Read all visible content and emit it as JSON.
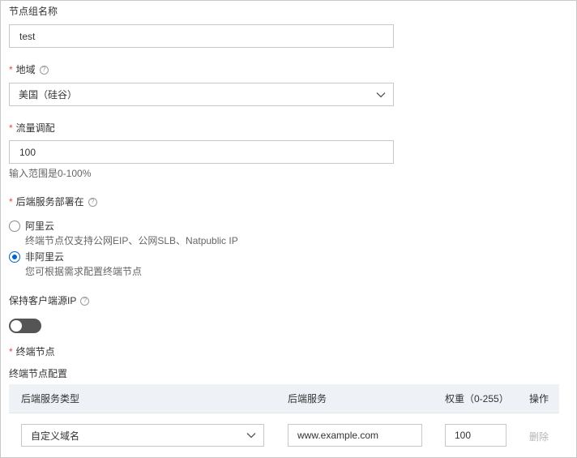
{
  "form": {
    "group_name": {
      "label": "节点组名称",
      "value": "test"
    },
    "region": {
      "label": "地域",
      "value": "美国（硅谷）",
      "required": true
    },
    "traffic": {
      "label": "流量调配",
      "value": "100",
      "hint": "输入范围是0-100%",
      "required": true
    },
    "backend": {
      "label": "后端服务部署在",
      "required": true,
      "options": [
        {
          "title": "阿里云",
          "desc": "终端节点仅支持公网EIP、公网SLB、Natpublic IP",
          "checked": false
        },
        {
          "title": "非阿里云",
          "desc": "您可根据需求配置终端节点",
          "checked": true
        }
      ]
    },
    "keep_ip": {
      "label": "保持客户端源IP",
      "enabled": false
    },
    "endpoint": {
      "label": "终端节点",
      "required": true
    },
    "endpoint_config": {
      "label": "终端节点配置"
    }
  },
  "table": {
    "headers": [
      "后端服务类型",
      "后端服务",
      "权重（0-255）",
      "操作"
    ],
    "rows": [
      {
        "type": "自定义域名",
        "service": "www.example.com",
        "weight": "100",
        "action": "删除"
      }
    ]
  },
  "icons": {
    "help": "question-circle-icon",
    "chevron": "chevron-down-icon"
  },
  "colors": {
    "accent": "#0064c8",
    "required": "#e5484d",
    "header_bg": "#eef1f6"
  },
  "required_mark": "*",
  "help_glyph": "?"
}
